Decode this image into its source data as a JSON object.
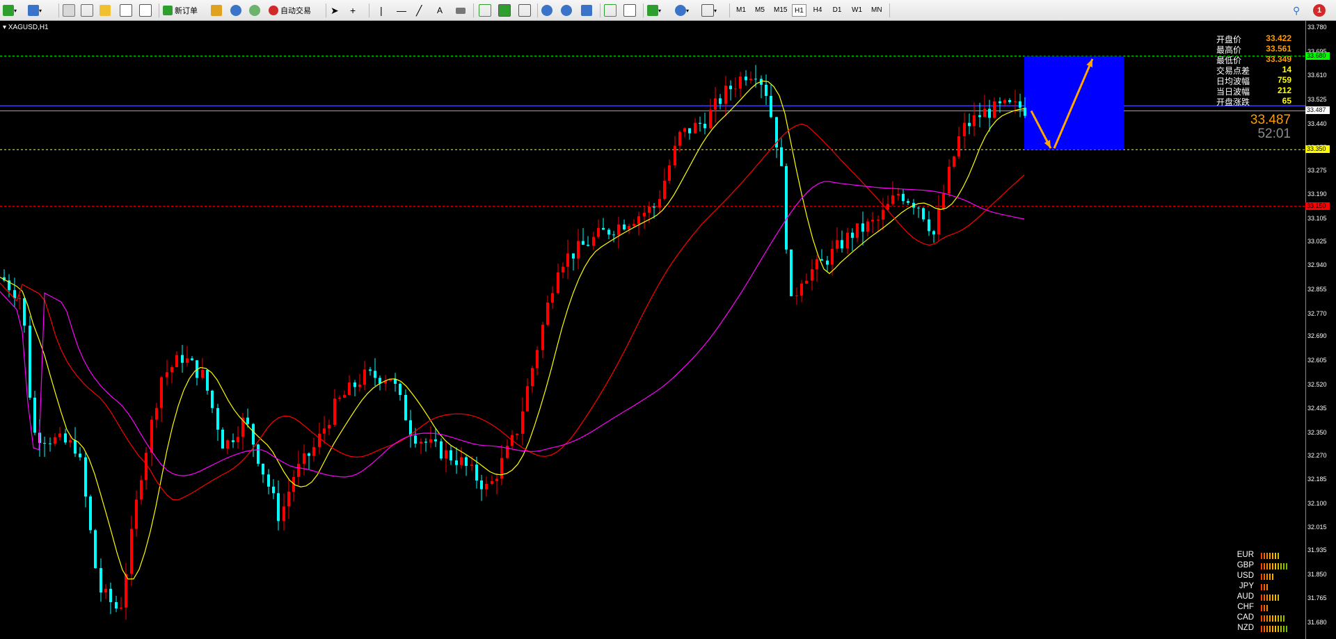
{
  "toolbar": {
    "new_order": "新订单",
    "auto_trade": "自动交易",
    "timeframes": [
      "M1",
      "M5",
      "M15",
      "H1",
      "H4",
      "D1",
      "W1",
      "MN"
    ],
    "active_timeframe": "H1",
    "notification_count": "1"
  },
  "chart": {
    "symbol": "XAGUSD,H1",
    "current_price": "33.487",
    "timer": "52:01",
    "colors": {
      "bull": "#ff0000",
      "bear": "#00ffff",
      "ma_fast": "#ffff00",
      "ma_mid": "#ff0000",
      "ma_slow": "#ff00ff",
      "box": "#0000ff",
      "arrow": "#ffa500"
    }
  },
  "info_panel": [
    {
      "label": "开盘价",
      "value": "33.422",
      "color": "#ff9c00"
    },
    {
      "label": "最高价",
      "value": "33.561",
      "color": "#ff9c00"
    },
    {
      "label": "最低价",
      "value": "33.349",
      "color": "#ff9c00"
    },
    {
      "label": "交易点差",
      "value": "14",
      "color": "#ffff00"
    },
    {
      "label": "日均波幅",
      "value": "759",
      "color": "#ffff00"
    },
    {
      "label": "当日波幅",
      "value": "212",
      "color": "#ffff00"
    },
    {
      "label": "开盘涨跌",
      "value": "65",
      "color": "#ffff00"
    }
  ],
  "price_axis": {
    "labels": [
      "33.780",
      "33.695",
      "33.610",
      "33.525",
      "33.440",
      "33.355",
      "33.275",
      "33.190",
      "33.105",
      "33.025",
      "32.940",
      "32.855",
      "32.770",
      "32.690",
      "32.605",
      "32.520",
      "32.435",
      "32.350",
      "32.270",
      "32.185",
      "32.100",
      "32.015",
      "31.935",
      "31.850",
      "31.765",
      "31.680"
    ],
    "highlights": [
      {
        "value": "33.680",
        "bg": "#00ff00",
        "fg": "#000"
      },
      {
        "value": "33.487",
        "bg": "#ffffff",
        "fg": "#000"
      },
      {
        "value": "33.350",
        "bg": "#ffff00",
        "fg": "#000"
      },
      {
        "value": "33.150",
        "bg": "#ff0000",
        "fg": "#000"
      }
    ]
  },
  "currency_strength": [
    {
      "code": "EUR",
      "bars": 7
    },
    {
      "code": "GBP",
      "bars": 10
    },
    {
      "code": "USD",
      "bars": 5
    },
    {
      "code": "JPY",
      "bars": 3
    },
    {
      "code": "AUD",
      "bars": 7
    },
    {
      "code": "CHF",
      "bars": 3
    },
    {
      "code": "CAD",
      "bars": 9
    },
    {
      "code": "NZD",
      "bars": 10
    }
  ]
}
